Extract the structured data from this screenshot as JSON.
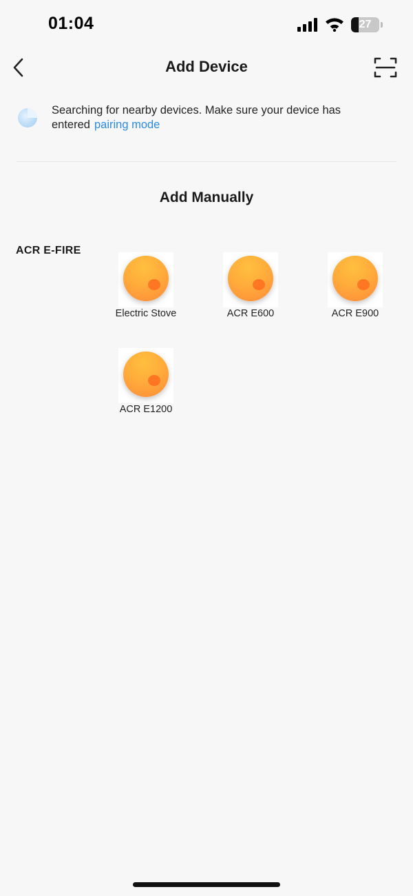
{
  "status_bar": {
    "time": "01:04",
    "battery_level": "27",
    "battery_fraction": 0.27
  },
  "header": {
    "title": "Add Device",
    "back_icon": "chevron-left-icon",
    "scan_icon": "scan-icon"
  },
  "search": {
    "message": "Searching for nearby devices. Make sure your device has entered",
    "link_text": "pairing mode",
    "link_color": "#2a8ae0"
  },
  "manual": {
    "title": "Add Manually",
    "brand": "ACR E-FIRE",
    "devices": [
      {
        "name": "Electric Stove",
        "icon": "fireplace-icon"
      },
      {
        "name": "ACR E600",
        "icon": "fireplace-icon"
      },
      {
        "name": "ACR E900",
        "icon": "fireplace-icon"
      },
      {
        "name": "ACR E1200",
        "icon": "fireplace-icon"
      }
    ]
  },
  "colors": {
    "background": "#f7f7f7",
    "accent": "#2a8ae0",
    "device_orange": "#ffac3b"
  }
}
